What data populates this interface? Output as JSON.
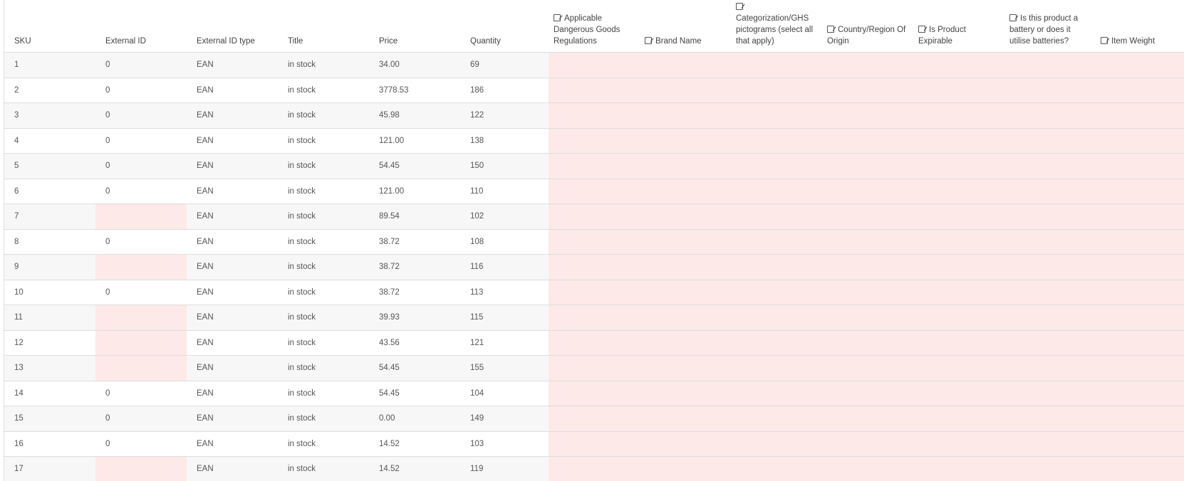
{
  "columns": [
    {
      "label": "SKU",
      "checkbox": false
    },
    {
      "label": "External ID",
      "checkbox": false
    },
    {
      "label": "External ID type",
      "checkbox": false
    },
    {
      "label": "Title",
      "checkbox": false
    },
    {
      "label": "Price",
      "checkbox": false
    },
    {
      "label": "Quantity",
      "checkbox": false
    },
    {
      "label": "Applicable Dangerous Goods Regulations",
      "checkbox": true
    },
    {
      "label": "Brand Name",
      "checkbox": true
    },
    {
      "label": "Categorization/GHS pictograms (select all that apply)",
      "checkbox": true
    },
    {
      "label": "Country/Region Of Origin",
      "checkbox": true
    },
    {
      "label": "Is Product Expirable",
      "checkbox": true
    },
    {
      "label": "Is this product a battery or does it utilise batteries?",
      "checkbox": true
    },
    {
      "label": "Item Weight",
      "checkbox": true
    }
  ],
  "rows": [
    {
      "sku": "1",
      "external_id": "0",
      "external_id_type": "EAN",
      "title": "in stock",
      "price": "34.00",
      "quantity": "69"
    },
    {
      "sku": "2",
      "external_id": "0",
      "external_id_type": "EAN",
      "title": "in stock",
      "price": "3778.53",
      "quantity": "186"
    },
    {
      "sku": "3",
      "external_id": "0",
      "external_id_type": "EAN",
      "title": "in stock",
      "price": "45.98",
      "quantity": "122"
    },
    {
      "sku": "4",
      "external_id": "0",
      "external_id_type": "EAN",
      "title": "in stock",
      "price": "121.00",
      "quantity": "138"
    },
    {
      "sku": "5",
      "external_id": "0",
      "external_id_type": "EAN",
      "title": "in stock",
      "price": "54.45",
      "quantity": "150"
    },
    {
      "sku": "6",
      "external_id": "0",
      "external_id_type": "EAN",
      "title": "in stock",
      "price": "121.00",
      "quantity": "110"
    },
    {
      "sku": "7",
      "external_id": "",
      "external_id_type": "EAN",
      "title": "in stock",
      "price": "89.54",
      "quantity": "102"
    },
    {
      "sku": "8",
      "external_id": "0",
      "external_id_type": "EAN",
      "title": "in stock",
      "price": "38.72",
      "quantity": "108"
    },
    {
      "sku": "9",
      "external_id": "",
      "external_id_type": "EAN",
      "title": "in stock",
      "price": "38.72",
      "quantity": "116"
    },
    {
      "sku": "10",
      "external_id": "0",
      "external_id_type": "EAN",
      "title": "in stock",
      "price": "38.72",
      "quantity": "113"
    },
    {
      "sku": "11",
      "external_id": "",
      "external_id_type": "EAN",
      "title": "in stock",
      "price": "39.93",
      "quantity": "115"
    },
    {
      "sku": "12",
      "external_id": "",
      "external_id_type": "EAN",
      "title": "in stock",
      "price": "43.56",
      "quantity": "121"
    },
    {
      "sku": "13",
      "external_id": "",
      "external_id_type": "EAN",
      "title": "in stock",
      "price": "54.45",
      "quantity": "155"
    },
    {
      "sku": "14",
      "external_id": "0",
      "external_id_type": "EAN",
      "title": "in stock",
      "price": "54.45",
      "quantity": "104"
    },
    {
      "sku": "15",
      "external_id": "0",
      "external_id_type": "EAN",
      "title": "in stock",
      "price": "0.00",
      "quantity": "149"
    },
    {
      "sku": "16",
      "external_id": "0",
      "external_id_type": "EAN",
      "title": "in stock",
      "price": "14.52",
      "quantity": "103"
    },
    {
      "sku": "17",
      "external_id": "",
      "external_id_type": "EAN",
      "title": "in stock",
      "price": "14.52",
      "quantity": "119"
    }
  ],
  "colors": {
    "error_cell": "#fde9e7",
    "row_alt": "#f7f7f7",
    "border": "#dedede"
  },
  "icons": {
    "header_checkbox": "checkbox-edit-icon"
  }
}
